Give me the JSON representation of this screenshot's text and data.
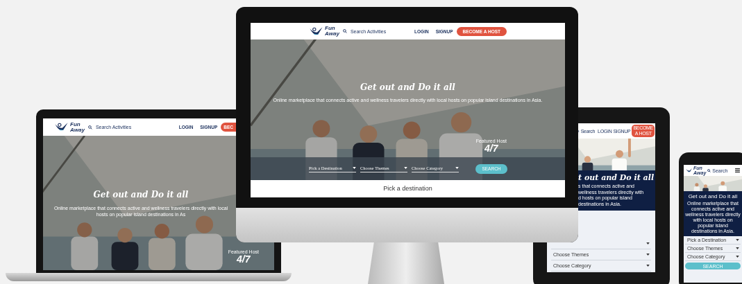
{
  "laptop": {
    "logo": {
      "line1": "Fun",
      "line2": "Away"
    },
    "search": "Search Activities",
    "nav": [
      "LOGIN",
      "SIGNUP"
    ],
    "cta": "BEC",
    "title": "Get out and Do it all",
    "subtitle": "Online marketplace that connects active and wellness travelers directly with local hosts on popular island destinations in As",
    "feature_label": "Featured Host",
    "counter": "4/7"
  },
  "monitor": {
    "logo": {
      "line1": "Fun",
      "line2": "Away"
    },
    "search": "Search Activities",
    "nav": [
      "LOGIN",
      "SIGNUP"
    ],
    "cta": "BECOME A HOST",
    "title": "Get out and Do it all",
    "subtitle": "Online marketplace that connects active and wellness travelers directly with local hosts on popular island destinations in Asia.",
    "feature_label": "Featured Host",
    "counter": "4/7",
    "dropdowns": [
      "Pick a Destination",
      "Choose Themes",
      "Choose Category"
    ],
    "search_button": "SEARCH",
    "section_title": "Pick a destination"
  },
  "tablet": {
    "search": "Search",
    "nav": [
      "LOGIN",
      "SIGNUP"
    ],
    "cta": "BECOME A HOST",
    "title": "t out and Do it all",
    "subtitle_lines": [
      "s that connects active and wellness travelers directly with",
      "d hosts on popular island destinations in Asia."
    ],
    "partial_dropdown": true,
    "dropdowns": [
      "Choose Themes",
      "Choose Category"
    ]
  },
  "phone": {
    "logo": {
      "line1": "Fun",
      "line2": "Away"
    },
    "search": "Search",
    "title": "Get out and Do it all",
    "subtitle": "Online marketplace that connects active and wellness travelers directly with local hosts on popular island destinations in Asia.",
    "dropdowns": [
      "Pick a Destination",
      "Choose Themes",
      "Choose Category"
    ],
    "search_button": "SEARCH"
  }
}
